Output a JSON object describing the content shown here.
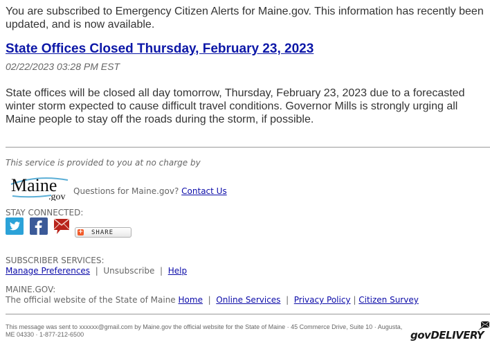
{
  "intro": "You are subscribed to Emergency Citizen Alerts for Maine.gov. This information has recently been updated, and is now available.",
  "article": {
    "headline": "State Offices Closed Thursday, February 23, 2023",
    "dateline": "02/22/2023 03:28 PM EST",
    "body": "State offices will be closed all day tomorrow, Thursday, February 23, 2023 due to a forecasted winter storm expected to cause difficult travel conditions. Governor Mills is strongly urging all Maine people to stay off the roads during the storm, if possible."
  },
  "provider": {
    "service_note": "This service is provided to you at no charge by",
    "logo_main": "Maine",
    "logo_sub": ".gov",
    "questions_text": "Questions for Maine.gov?",
    "contact_link": "Contact Us"
  },
  "stay_connected": {
    "heading": "STAY CONNECTED:",
    "icons": [
      "twitter-icon",
      "facebook-icon",
      "email-icon"
    ],
    "share_label": "SHARE",
    "share_icon": "+"
  },
  "subscriber_services": {
    "heading": "SUBSCRIBER SERVICES:",
    "manage": "Manage Preferences",
    "unsubscribe": "Unsubscribe",
    "help": "Help",
    "separator": "|"
  },
  "maine_gov": {
    "heading": "MAINE.GOV:",
    "description": "The official website of the State of Maine",
    "links": [
      "Home",
      "Online Services",
      "Privacy Policy",
      "Citizen Survey"
    ],
    "separator": "|"
  },
  "footer": {
    "message": "This message was sent to xxxxxx@gmail.com by Maine.gov the official website for the State of Maine · 45 Commerce Drive, Suite 10 · Augusta, ME 04330 · 1-877-212-6500",
    "brand": "govDELIVERY"
  },
  "colors": {
    "link": "#0b0ba8",
    "text": "#333333",
    "muted": "#666666",
    "twitter": "#2ba2d8",
    "facebook": "#3b5a98",
    "email": "#b8231b",
    "share_plus": "#f15a29"
  }
}
